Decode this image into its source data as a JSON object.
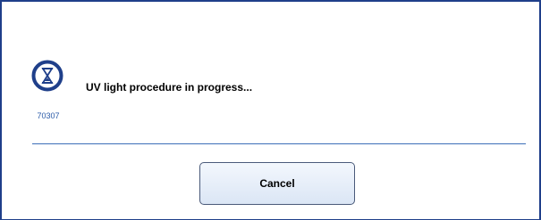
{
  "dialog": {
    "message": "UV light procedure in progress...",
    "status_code": "70307",
    "status_icon": "hourglass-icon",
    "accent_color": "#1f3f8a"
  },
  "actions": {
    "cancel_label": "Cancel"
  }
}
